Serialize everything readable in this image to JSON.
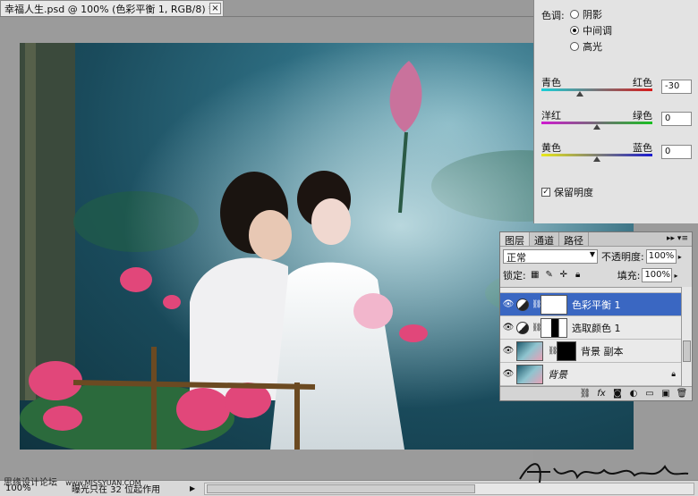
{
  "document": {
    "tab_title": "幸福人生.psd @ 100% (色彩平衡 1, RGB/8) *",
    "close_glyph": "×"
  },
  "color_balance": {
    "tone_label": "色调:",
    "tones": [
      {
        "label": "阴影",
        "checked": false
      },
      {
        "label": "中间调",
        "checked": true
      },
      {
        "label": "高光",
        "checked": false
      }
    ],
    "sliders": [
      {
        "left": "青色",
        "right": "红色",
        "value": "-30",
        "level": -30
      },
      {
        "left": "洋红",
        "right": "绿色",
        "value": "0",
        "level": 0
      },
      {
        "left": "黄色",
        "right": "蓝色",
        "value": "0",
        "level": 0
      }
    ],
    "preserve_luminosity": {
      "label": "保留明度",
      "checked": true
    }
  },
  "layers_panel": {
    "tabs": [
      "图层",
      "通道",
      "路径"
    ],
    "menu_glyph": "▸▸ ▾≡",
    "blend_mode": "正常",
    "opacity_label": "不透明度:",
    "opacity_value": "100%",
    "lock_label": "锁定:",
    "fill_label": "填充:",
    "fill_value": "100%",
    "layers": [
      {
        "name": "色彩平衡 1",
        "type": "adjustment",
        "selected": true
      },
      {
        "name": "选取颜色 1",
        "type": "adjustment-mask",
        "selected": false
      },
      {
        "name": "背景 副本",
        "type": "photo-mask",
        "selected": false
      },
      {
        "name": "背景",
        "type": "photo",
        "selected": false
      }
    ],
    "footer_icons": [
      "link-icon",
      "fx-icon",
      "mask-icon",
      "adjustment-icon",
      "group-icon",
      "new-layer-icon",
      "trash-icon"
    ]
  },
  "statusbar": {
    "zoom": "100%",
    "info": "曝光只在 32 位起作用",
    "left_watermark": "思缘设计论坛",
    "url_watermark": "www.MISSYUAN.COM",
    "signature": "Xuosharrizuo"
  },
  "colors": {
    "selection": "#3a67c2",
    "cyan": "#18d0d8",
    "red": "#d91a1a",
    "magenta": "#d018d0",
    "green": "#18c020",
    "yellow": "#e8e818",
    "blue": "#1a1ad0"
  }
}
